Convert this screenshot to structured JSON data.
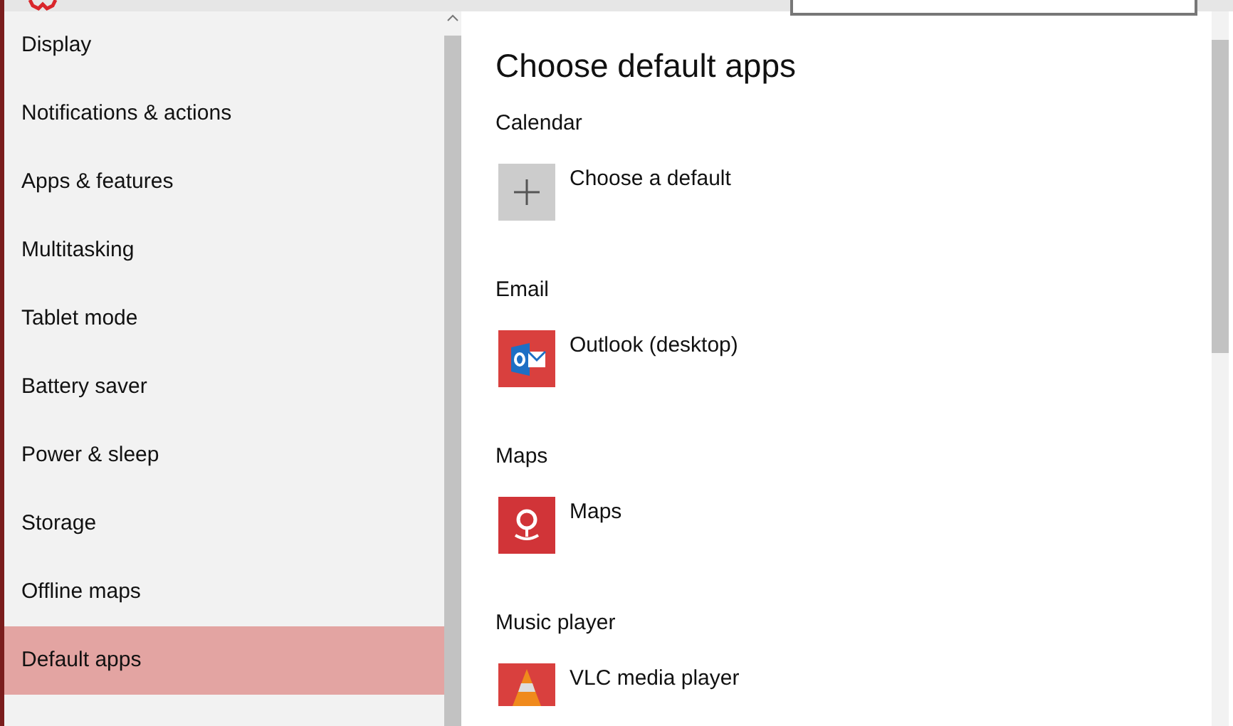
{
  "sidebar": {
    "items": [
      {
        "label": "Display",
        "selected": false
      },
      {
        "label": "Notifications & actions",
        "selected": false
      },
      {
        "label": "Apps & features",
        "selected": false
      },
      {
        "label": "Multitasking",
        "selected": false
      },
      {
        "label": "Tablet mode",
        "selected": false
      },
      {
        "label": "Battery saver",
        "selected": false
      },
      {
        "label": "Power & sleep",
        "selected": false
      },
      {
        "label": "Storage",
        "selected": false
      },
      {
        "label": "Offline maps",
        "selected": false
      },
      {
        "label": "Default apps",
        "selected": true
      }
    ]
  },
  "content": {
    "title": "Choose default apps",
    "sections": [
      {
        "heading": "Calendar",
        "app": "Choose a default",
        "kind": "add"
      },
      {
        "heading": "Email",
        "app": "Outlook (desktop)",
        "kind": "outlook"
      },
      {
        "heading": "Maps",
        "app": "Maps",
        "kind": "maps"
      },
      {
        "heading": "Music player",
        "app": "VLC media player",
        "kind": "vlc"
      }
    ]
  }
}
